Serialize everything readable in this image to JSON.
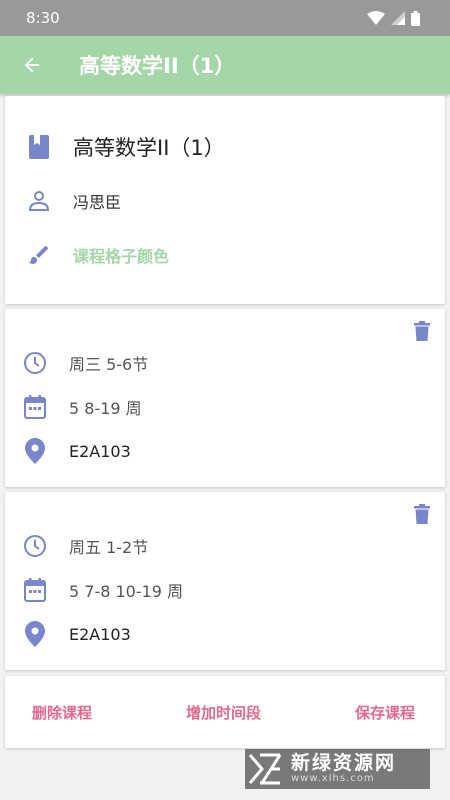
{
  "status": {
    "time": "8:30"
  },
  "header": {
    "title": "高等数学II（1）"
  },
  "info": {
    "course_name": "高等数学II（1）",
    "teacher": "冯思臣",
    "color_label": "课程格子颜色"
  },
  "slots": [
    {
      "time": "周三 5-6节",
      "weeks": "5 8-19 周",
      "room": "E2A103"
    },
    {
      "time": "周五 1-2节",
      "weeks": "5 7-8 10-19 周",
      "room": "E2A103"
    }
  ],
  "actions": {
    "delete_label": "删除课程",
    "add_label": "增加时间段",
    "save_label": "保存课程"
  },
  "watermark": {
    "name": "新绿资源网",
    "url": "www.xlhs.com"
  },
  "colors": {
    "accent": "#a5d6a7",
    "icon": "#7986cb",
    "action": "#e06b8b"
  }
}
